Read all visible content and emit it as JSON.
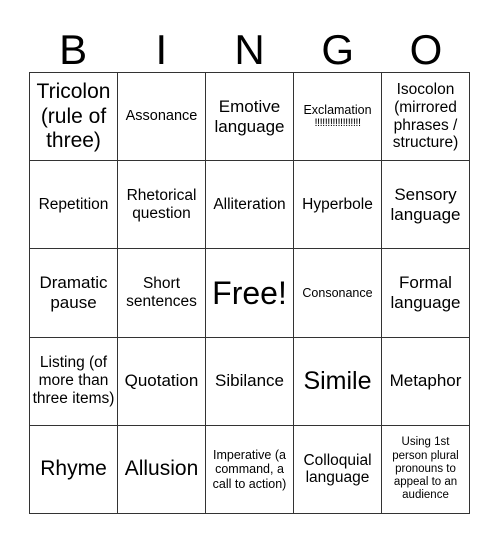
{
  "header": [
    "B",
    "I",
    "N",
    "G",
    "O"
  ],
  "cells": [
    [
      "Tricolon (rule of three)",
      "Assonance",
      "Emotive language",
      "Exclamation !!!!!!!!!!!!!!!!!!",
      "Isocolon (mirrored phrases / structure)"
    ],
    [
      "Repetition",
      "Rhetorical question",
      "Alliteration",
      "Hyperbole",
      "Sensory language"
    ],
    [
      "Dramatic pause",
      "Short sentences",
      "Free!",
      "Consonance",
      "Formal language"
    ],
    [
      "Listing (of more than three items)",
      "Quotation",
      "Sibilance",
      "Simile",
      "Metaphor"
    ],
    [
      "Rhyme",
      "Allusion",
      "Imperative (a command, a call to action)",
      "Colloquial language",
      "Using 1st person plural pronouns to appeal to an audience"
    ]
  ],
  "exclamation_word": "Exclamation",
  "exclamation_marks": "!!!!!!!!!!!!!!!!!!"
}
